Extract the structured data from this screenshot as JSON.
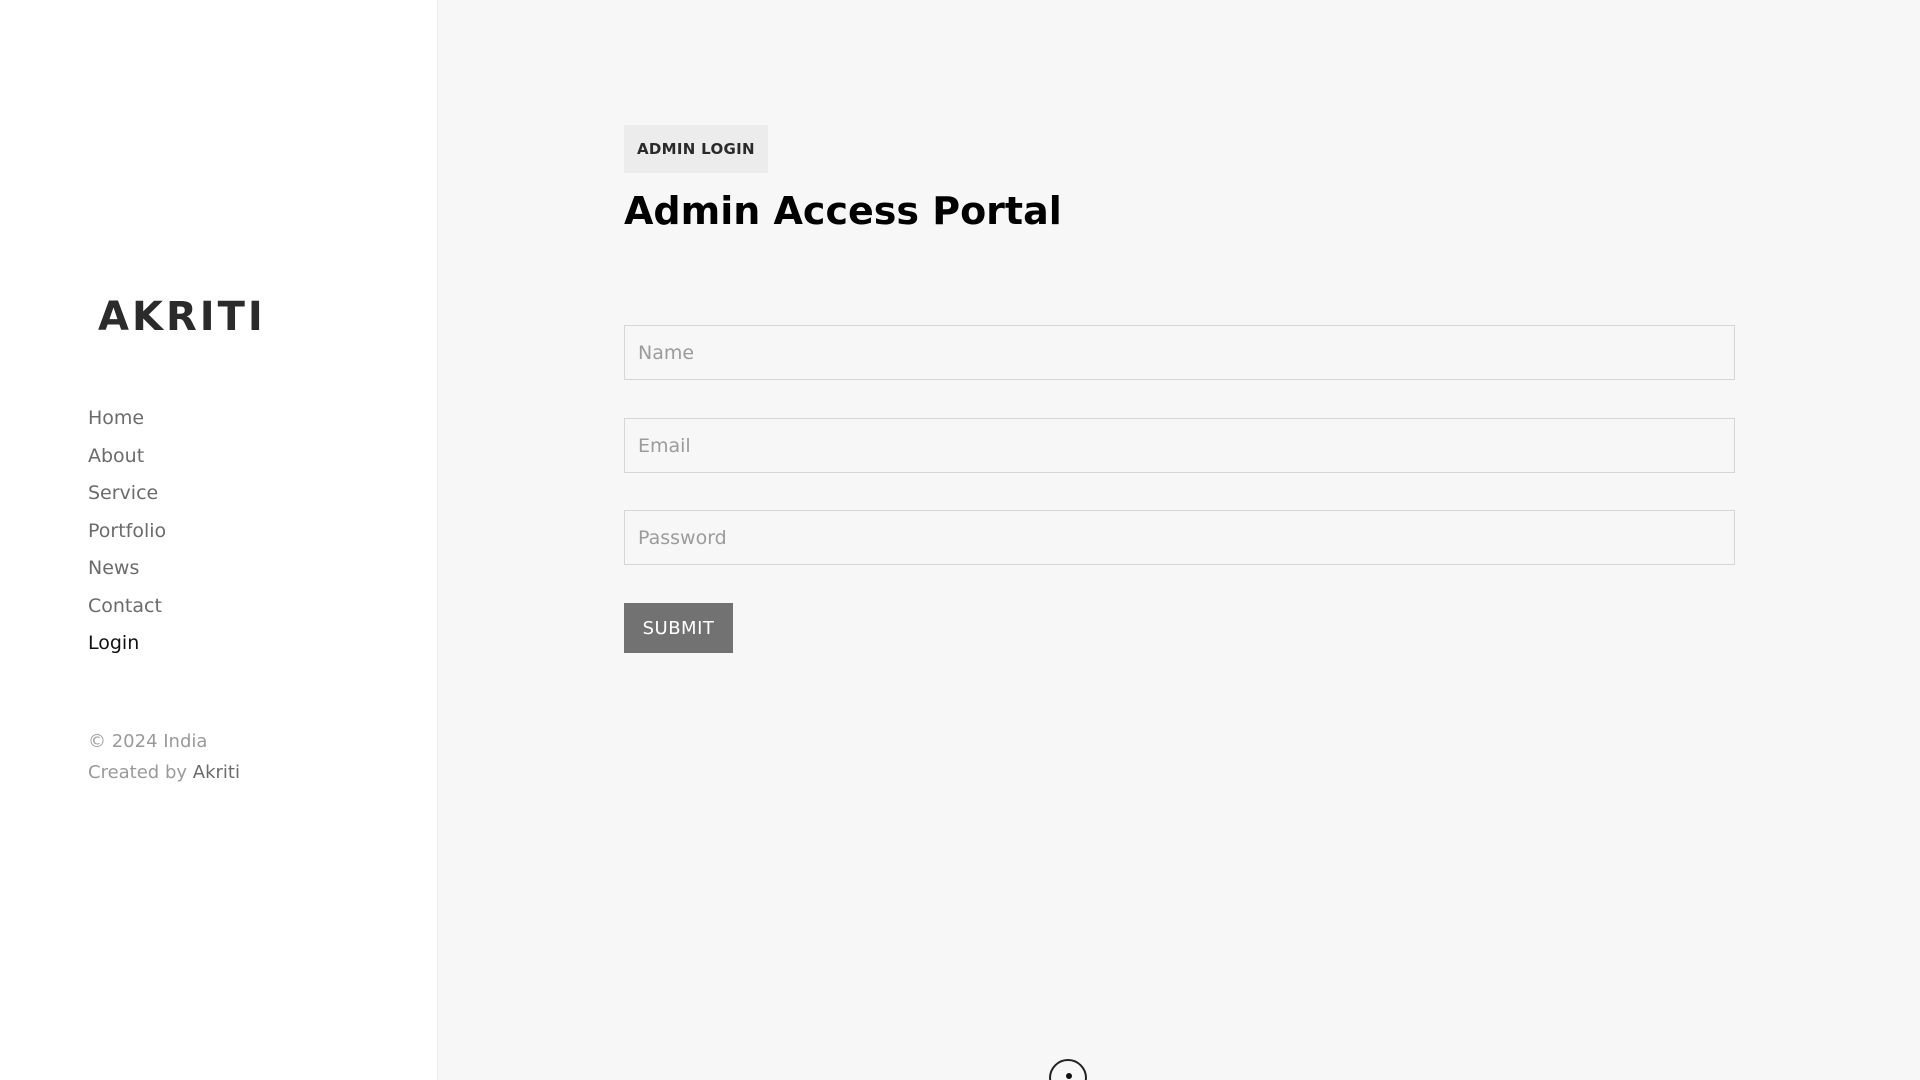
{
  "brand": {
    "logo_text": "AKRITI"
  },
  "nav": {
    "items": [
      {
        "label": "Home"
      },
      {
        "label": "About"
      },
      {
        "label": "Service"
      },
      {
        "label": "Portfolio"
      },
      {
        "label": "News"
      },
      {
        "label": "Contact"
      },
      {
        "label": "Login"
      }
    ],
    "active": "Login"
  },
  "footer": {
    "copyright": "© 2024 India",
    "created_by_prefix": "Created by ",
    "created_by_name": "Akriti"
  },
  "main": {
    "badge": "ADMIN LOGIN",
    "title": "Admin Access Portal",
    "form": {
      "name_placeholder": "Name",
      "email_placeholder": "Email",
      "password_placeholder": "Password",
      "submit_label": "SUBMIT"
    }
  },
  "colors": {
    "page_background": "#f7f7f7",
    "sidebar_background": "#ffffff",
    "submit_background": "#727272",
    "nav_text": "#6b6b6b",
    "nav_active_text": "#111111"
  },
  "icons": {
    "scroll_indicator": "scroll-down-icon"
  }
}
